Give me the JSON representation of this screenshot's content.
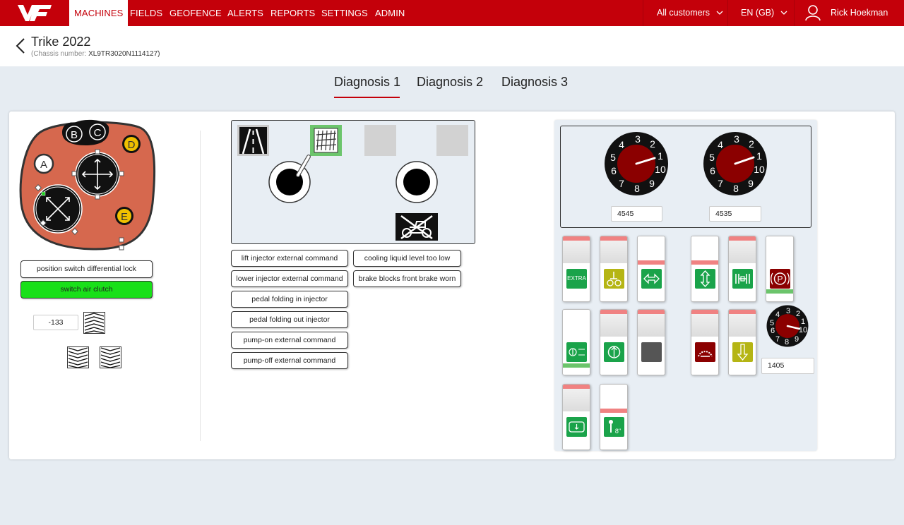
{
  "nav": {
    "items": [
      {
        "label": "MACHINES",
        "active": true
      },
      {
        "label": "FIELDS",
        "active": false
      },
      {
        "label": "GEOFENCE",
        "active": false
      },
      {
        "label": "ALERTS",
        "active": false
      },
      {
        "label": "REPORTS",
        "active": false
      },
      {
        "label": "SETTINGS",
        "active": false
      },
      {
        "label": "ADMIN",
        "active": false
      }
    ],
    "customers_label": "All customers",
    "language_label": "EN (GB)",
    "user_name": "Rick Hoekman",
    "brand_color": "#c4000a"
  },
  "header": {
    "title": "Trike 2022",
    "chassis_label": "(Chassis number:",
    "chassis_number": "XL9TR3020N1114127)"
  },
  "tabs": [
    "Diagnosis 1",
    "Diagnosis 2",
    "Diagnosis 3"
  ],
  "left": {
    "joystick_buttons": [
      "A",
      "B",
      "C",
      "D",
      "E"
    ],
    "status_buttons": [
      {
        "label": "position switch differential lock",
        "active": false
      },
      {
        "label": "switch air clutch",
        "active": true
      }
    ],
    "value": "-133"
  },
  "middle": {
    "buttons_col1": [
      "lift injector external command",
      "lower injector external command",
      "pedal folding in injector",
      "pedal folding out injector",
      "pump-on external command",
      "pump-off external command"
    ],
    "buttons_col2": [
      "cooling liquid level too low",
      "brake blocks front brake worn"
    ]
  },
  "right": {
    "gauge_labels": [
      "3",
      "2",
      "1",
      "10",
      "9",
      "8",
      "7",
      "6",
      "5",
      "4"
    ],
    "small_gauge_labels": [
      "3",
      "2",
      "1",
      "10",
      "9",
      "8",
      "7",
      "6",
      "5",
      "4"
    ],
    "gauge1_value": "4545",
    "gauge2_value": "4535",
    "gauge3_value": "1405",
    "switch_extra_label": "EXTRA",
    "accent_green": "#1aa34a",
    "accent_red": "#8b0000"
  }
}
